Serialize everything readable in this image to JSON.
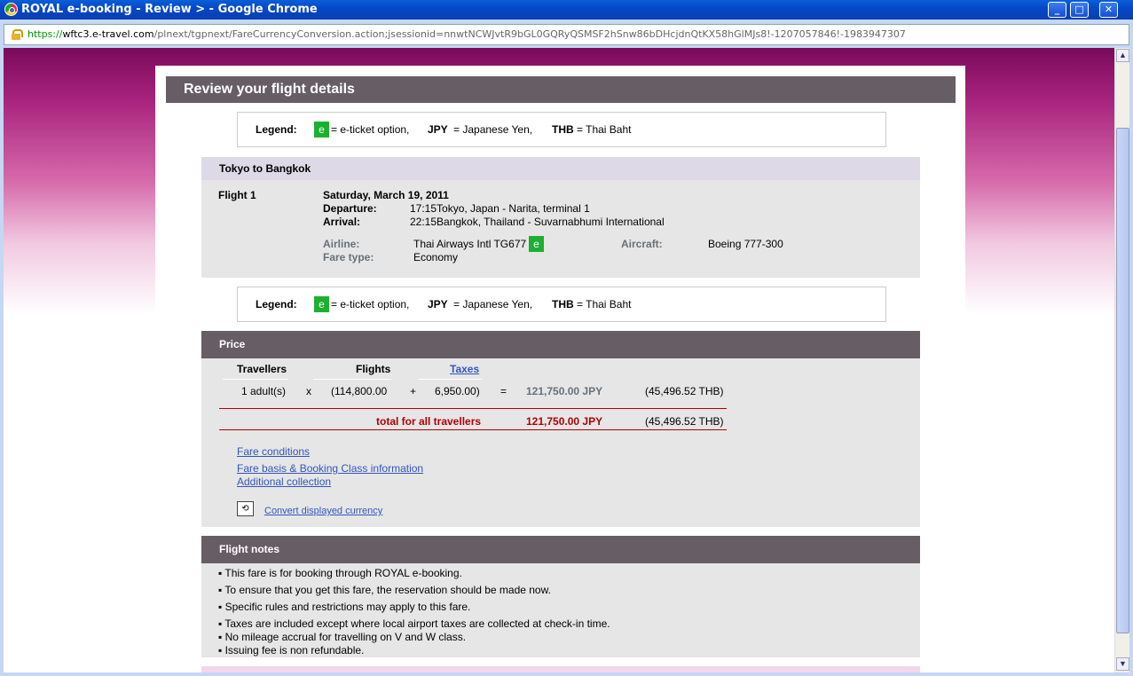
{
  "window": {
    "title": "ROYAL e-booking - Review > - Google Chrome"
  },
  "address": {
    "scheme": "https://",
    "host": "wftc3.e-travel.com",
    "path": "/plnext/tgpnext/FareCurrencyConversion.action;jsessionid=nnwtNCWJvtR9bGL0GQRyQSMSF2hSnw86bDHcjdnQtKX58hGlMJs8!-1207057846!-1983947307"
  },
  "page": {
    "title": "Review your flight details"
  },
  "legend": {
    "label": "Legend:",
    "e_badge": "e",
    "e_text": "= e-ticket option,",
    "jpy_code": "JPY",
    "jpy_text": "= Japanese Yen,",
    "thb_code": "THB",
    "thb_text": "= Thai Baht"
  },
  "route": {
    "title": "Tokyo to Bangkok"
  },
  "flight": {
    "label": "Flight 1",
    "date": "Saturday, March 19, 2011",
    "departure_label": "Departure:",
    "departure_value": "17:15Tokyo, Japan - Narita, terminal 1",
    "arrival_label": "Arrival:",
    "arrival_value": "22:15Bangkok, Thailand - Suvarnabhumi International",
    "airline_label": "Airline:",
    "airline_value": "Thai Airways Intl TG677",
    "fare_type_label": "Fare type:",
    "fare_type_value": "Economy",
    "aircraft_label": "Aircraft:",
    "aircraft_value": "Boeing 777-300"
  },
  "price": {
    "title": "Price",
    "col_travellers": "Travellers",
    "col_flights": "Flights",
    "col_taxes": "Taxes",
    "travellers": "1 adult(s)",
    "times": "x",
    "flights": "(114,800.00",
    "plus": "+",
    "taxes": "6,950.00)",
    "equals": "=",
    "total_jpy": "121,750.00 JPY",
    "total_thb": "(45,496.52 THB)",
    "grand_label": "total for all travellers",
    "grand_jpy": "121,750.00 JPY",
    "grand_thb": "(45,496.52 THB)",
    "links": [
      "Fare conditions",
      "Fare basis & Booking Class information",
      "Additional collection"
    ],
    "convert": "Convert displayed currency"
  },
  "notes": {
    "title": "Flight notes",
    "items": [
      "This fare is for booking through ROYAL e-booking.",
      "To ensure that you get this fare, the reservation should be made now.",
      "Specific rules and restrictions may apply to this fare.",
      "Taxes are included except where local airport taxes are collected at check-in time.",
      "No mileage accrual for travelling on V and W class.",
      "Issuing fee is non refundable."
    ]
  }
}
